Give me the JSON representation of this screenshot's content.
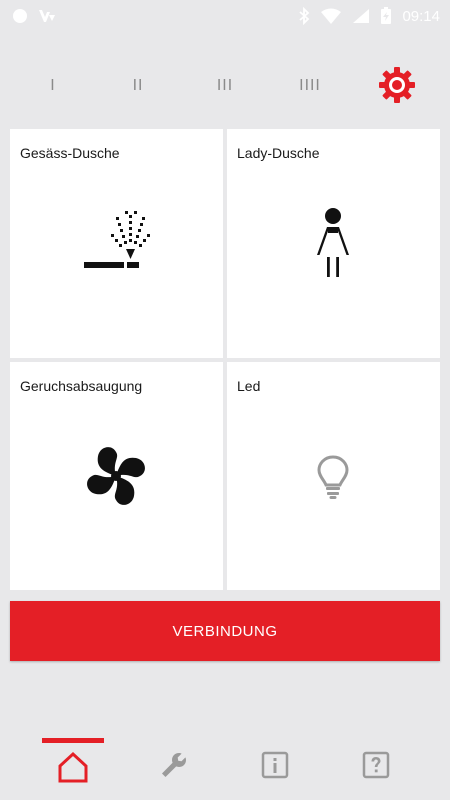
{
  "status_bar": {
    "time": "09:14",
    "icons": [
      "circle-icon",
      "notification-icon",
      "bluetooth-icon",
      "wifi-icon",
      "signal-icon",
      "battery-charging-icon"
    ]
  },
  "profiles": {
    "items": [
      "I",
      "II",
      "III",
      "IIII"
    ],
    "settings_icon": "gear-icon"
  },
  "tiles": [
    {
      "label": "Gesäss-Dusche",
      "icon": "spray-nozzle-icon"
    },
    {
      "label": "Lady-Dusche",
      "icon": "woman-icon"
    },
    {
      "label": "Geruchsabsaugung",
      "icon": "fan-icon"
    },
    {
      "label": "Led",
      "icon": "lightbulb-icon"
    }
  ],
  "connect_button": {
    "label": "VERBINDUNG"
  },
  "bottom_nav": {
    "items": [
      "home-icon",
      "wrench-icon",
      "info-icon",
      "help-icon"
    ],
    "active": "home-icon"
  },
  "colors": {
    "accent": "#e41f26",
    "background": "#e8e8ea",
    "tile": "#ffffff",
    "inactive_icon": "#9a9a9a"
  }
}
